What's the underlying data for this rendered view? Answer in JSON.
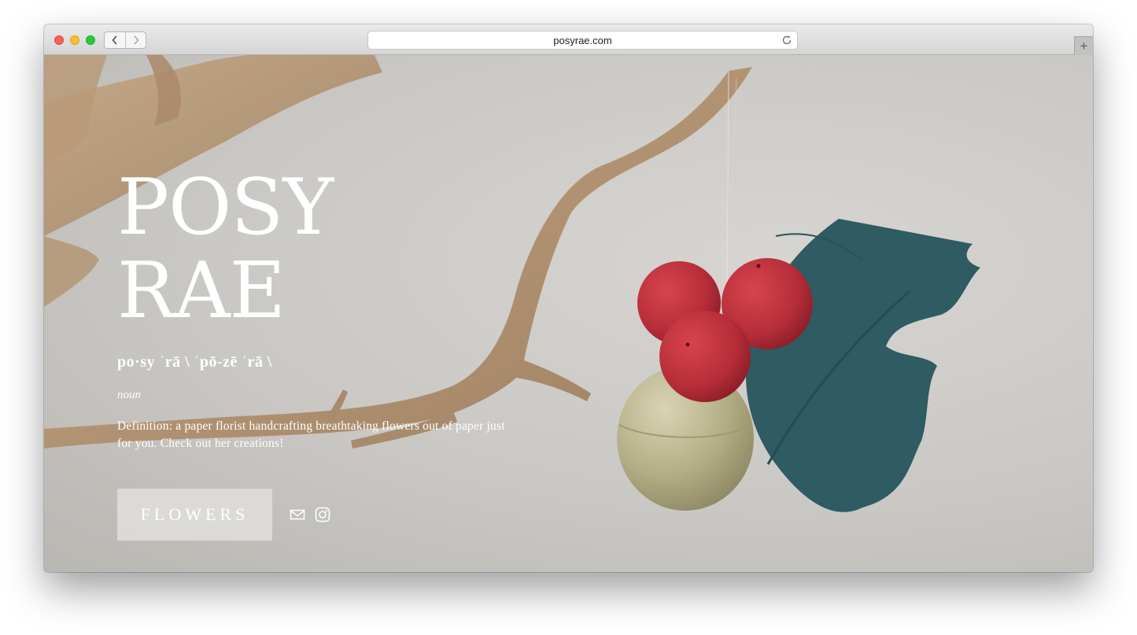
{
  "browser": {
    "url": "posyrae.com",
    "back_icon": "chevron-left-icon",
    "forward_icon": "chevron-right-icon",
    "reload_icon": "reload-icon",
    "new_tab_label": "+"
  },
  "hero": {
    "brand_line1": "POSY",
    "brand_line2": "RAE",
    "pronunciation": "po·sy ˈrā \\ ˈpō-zē ˈrā \\",
    "part_of_speech": "noun",
    "definition": "Definition: a paper florist handcrafting breathtaking flowers out of paper just for you. Check out her creations!",
    "cta_label": "FLOWERS",
    "social": [
      {
        "icon": "mail-icon"
      },
      {
        "icon": "instagram-icon"
      }
    ]
  },
  "colors": {
    "background": "#c9c7c2",
    "text": "#ffffff",
    "berry": "#c0323d",
    "leaf": "#2f5b62",
    "ornament": "#b5b08a",
    "branch": "#b89a7a"
  }
}
